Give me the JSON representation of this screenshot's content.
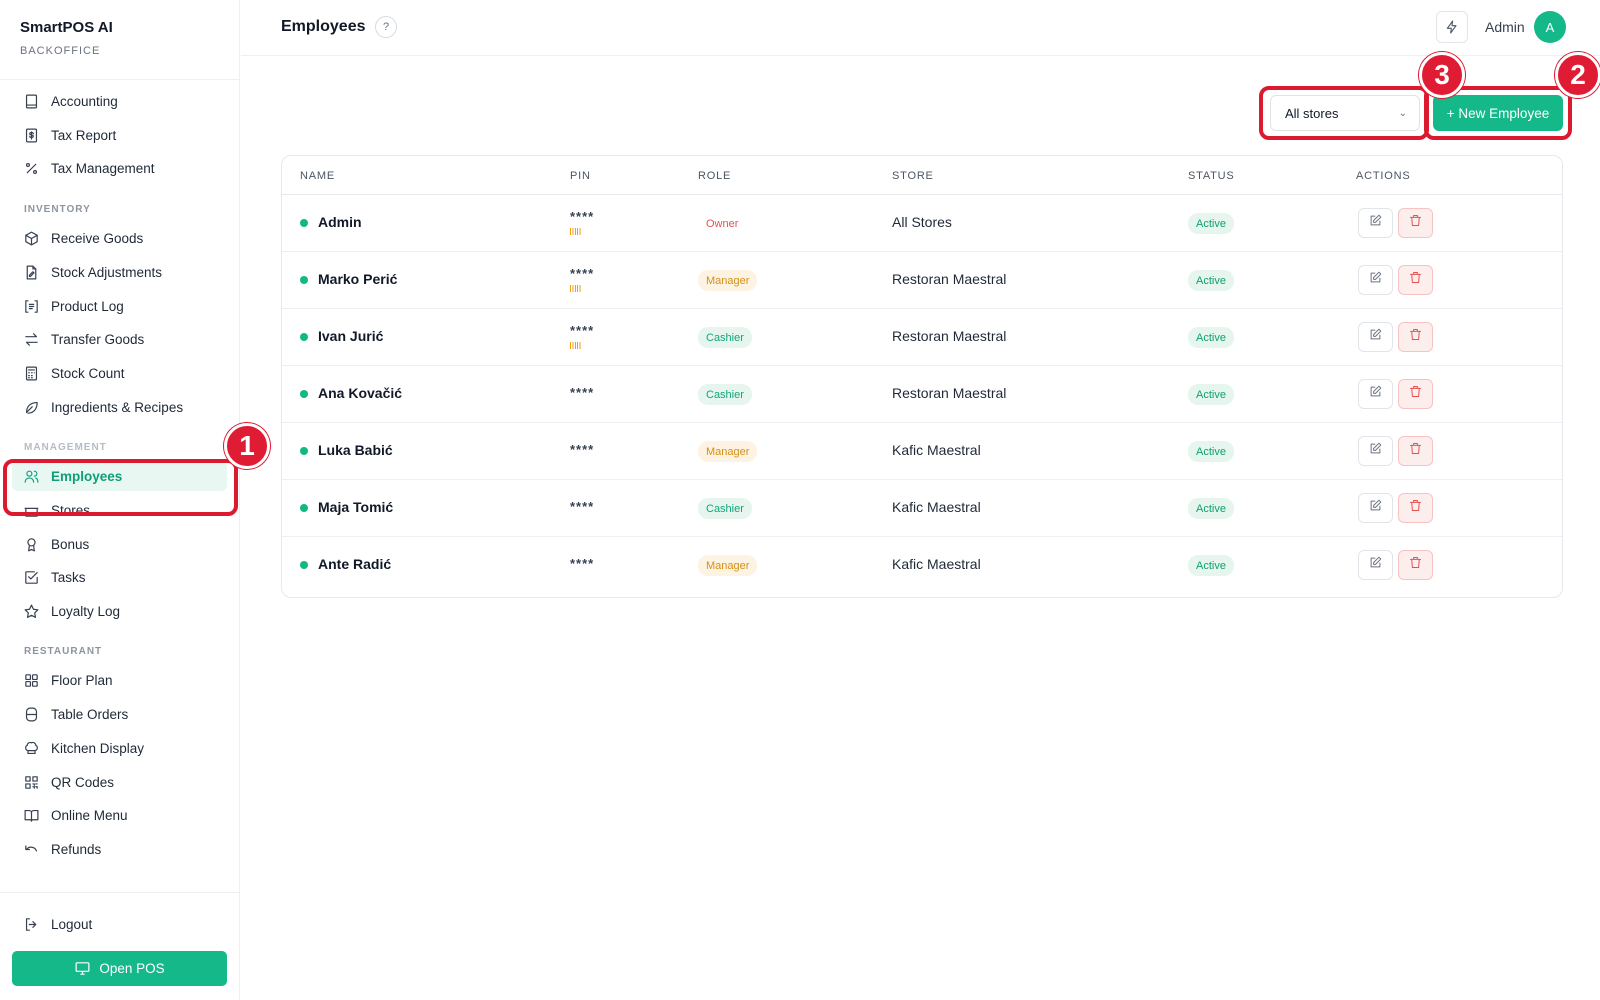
{
  "app": {
    "name": "SmartPOS AI",
    "subtitle": "BACKOFFICE"
  },
  "header": {
    "title": "Employees",
    "help": "?",
    "user_name": "Admin",
    "avatar_initial": "A"
  },
  "sidebar": {
    "items_top": [
      {
        "label": "Accounting",
        "icon": "book-icon"
      },
      {
        "label": "Tax Report",
        "icon": "receipt-icon"
      },
      {
        "label": "Tax Management",
        "icon": "percent-icon"
      }
    ],
    "section_inventory": "INVENTORY",
    "items_inventory": [
      {
        "label": "Receive Goods",
        "icon": "package-icon"
      },
      {
        "label": "Stock Adjustments",
        "icon": "file-edit-icon"
      },
      {
        "label": "Product Log",
        "icon": "list-icon"
      },
      {
        "label": "Transfer Goods",
        "icon": "transfer-icon"
      },
      {
        "label": "Stock Count",
        "icon": "calculator-icon"
      },
      {
        "label": "Ingredients & Recipes",
        "icon": "leaf-icon"
      }
    ],
    "section_management": "MANAGEMENT",
    "items_management": [
      {
        "label": "Employees",
        "icon": "users-icon",
        "active": true
      },
      {
        "label": "Stores",
        "icon": "store-icon"
      },
      {
        "label": "Bonus",
        "icon": "award-icon"
      },
      {
        "label": "Tasks",
        "icon": "checkbox-icon"
      },
      {
        "label": "Loyalty Log",
        "icon": "star-icon"
      }
    ],
    "section_restaurant": "RESTAURANT",
    "items_restaurant": [
      {
        "label": "Floor Plan",
        "icon": "grid-icon"
      },
      {
        "label": "Table Orders",
        "icon": "table-icon"
      },
      {
        "label": "Kitchen Display",
        "icon": "chef-hat-icon"
      },
      {
        "label": "QR Codes",
        "icon": "qr-icon"
      },
      {
        "label": "Online Menu",
        "icon": "open-book-icon"
      },
      {
        "label": "Refunds",
        "icon": "undo-icon"
      }
    ],
    "logout": "Logout",
    "open_pos": "Open POS"
  },
  "toolbar": {
    "store_filter": "All stores",
    "new_button": "+ New Employee"
  },
  "table": {
    "columns": [
      "NAME",
      "PIN",
      "ROLE",
      "STORE",
      "STATUS",
      "ACTIONS"
    ],
    "rows": [
      {
        "name": "Admin",
        "pin": "****",
        "has_barcode": true,
        "role": "Owner",
        "role_type": "owner",
        "store": "All Stores",
        "status": "Active"
      },
      {
        "name": "Marko Perić",
        "pin": "****",
        "has_barcode": true,
        "role": "Manager",
        "role_type": "manager",
        "store": "Restoran Maestral",
        "status": "Active"
      },
      {
        "name": "Ivan Jurić",
        "pin": "****",
        "has_barcode": true,
        "role": "Cashier",
        "role_type": "cashier",
        "store": "Restoran Maestral",
        "status": "Active"
      },
      {
        "name": "Ana Kovačić",
        "pin": "****",
        "has_barcode": false,
        "role": "Cashier",
        "role_type": "cashier",
        "store": "Restoran Maestral",
        "status": "Active"
      },
      {
        "name": "Luka Babić",
        "pin": "****",
        "has_barcode": false,
        "role": "Manager",
        "role_type": "manager",
        "store": "Kafic Maestral",
        "status": "Active"
      },
      {
        "name": "Maja Tomić",
        "pin": "****",
        "has_barcode": false,
        "role": "Cashier",
        "role_type": "cashier",
        "store": "Kafic Maestral",
        "status": "Active"
      },
      {
        "name": "Ante Radić",
        "pin": "****",
        "has_barcode": false,
        "role": "Manager",
        "role_type": "manager",
        "store": "Kafic Maestral",
        "status": "Active"
      }
    ]
  },
  "annotations": [
    "1",
    "2",
    "3"
  ],
  "colors": {
    "accent": "#14b889",
    "annotation": "#dc1a2f",
    "owner": "#e05252",
    "manager": "#d4901a",
    "cashier": "#12a57c"
  }
}
